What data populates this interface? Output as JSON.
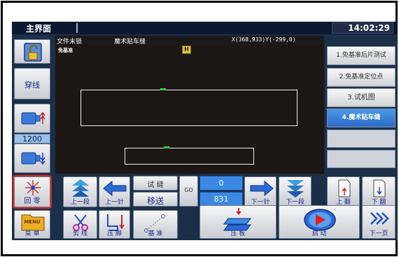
{
  "header": {
    "title": "主界面",
    "clock": "14:02:29"
  },
  "left": {
    "thread_label": "穿线",
    "speed": "1200",
    "home_label": "回 零",
    "menu_label": "菜 单",
    "menu_icon_text": "MENU"
  },
  "info": {
    "file_status": "文件未锁",
    "pattern_name": "魔术贴车缝",
    "coords": "X(368,933)Y(-299,0)"
  },
  "canvas": {
    "mode_tag": "免基准",
    "center_icon": "H"
  },
  "right_panel": {
    "items": [
      "1.免基准后片测试",
      "2.免基准定位点",
      "3.试机图",
      "4.魔术贴车缝"
    ]
  },
  "bottom": {
    "prev_segment": "上一段",
    "prev_stitch": "上一针",
    "trial_sew": "试 缝",
    "shift": "移送",
    "go": "GO",
    "stitch_start": "0",
    "stitch_count": "831",
    "next_stitch": "下一针",
    "next_segment": "下一段",
    "page_up": "上 翻",
    "page_down": "下 翻",
    "cut_thread": "剪 线",
    "presser_foot": "压 脚",
    "datum": "基 准",
    "press_plate": "压 板",
    "start": "启 动",
    "next_page": "下一页"
  },
  "colors": {
    "screen_bg": "#1b2f48",
    "canvas_bg": "#1c1614",
    "highlight_blue": "#3a8ae4",
    "selection_red": "#e0241c",
    "mark_green": "#30d030"
  }
}
